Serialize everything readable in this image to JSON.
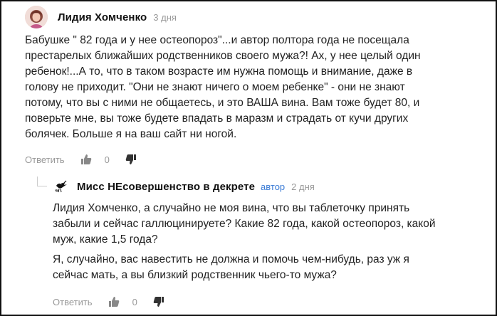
{
  "comments": [
    {
      "author": "Лидия Хомченко",
      "date": "3 дня",
      "avatar_icon": "user-photo-avatar",
      "text_lines": [
        "Бабушке \" 82 года и у нее остеопороз\"...и автор полтора года не посещала",
        "престарелых ближайших родственников своего мужа?! Ах, у нее целый один",
        "ребенок!...А то, что в таком возрасте им нужна помощь и внимание, даже в",
        "голову не приходит. \"Они не знают ничего о моем ребенке\" - они не знают",
        "потому, что вы с ними не общаетесь, и это ВАША вина. Вам тоже будет 80, и",
        "поверьте мне, вы тоже будете впадать в маразм и страдать от кучи других",
        "болячек. Больше я на ваш сайт ни ногой."
      ],
      "reply_label": "Ответить",
      "score": "0"
    },
    {
      "author": "Мисс НЕсовершенство в декрете",
      "badge": "автор",
      "date": "2 дня",
      "avatar_icon": "stork-avatar-icon",
      "paragraphs": [
        [
          "Лидия Хомченко, а случайно не моя вина, что вы таблеточку принять",
          "забыли и сейчас галлюцинируете? Какие 82 года, какой остеопороз, какой",
          "муж, какие 1,5 года?"
        ],
        [
          "Я, случайно, вас навестить не должна и помочь чем-нибудь, раз уж я",
          "сейчас мать, а вы близкий родственник чьего-то мужа?"
        ]
      ],
      "reply_label": "Ответить",
      "score": "0"
    }
  ],
  "colors": {
    "text": "#222222",
    "muted": "#999999",
    "author_badge": "#3a7bd5",
    "border": "#111111"
  }
}
